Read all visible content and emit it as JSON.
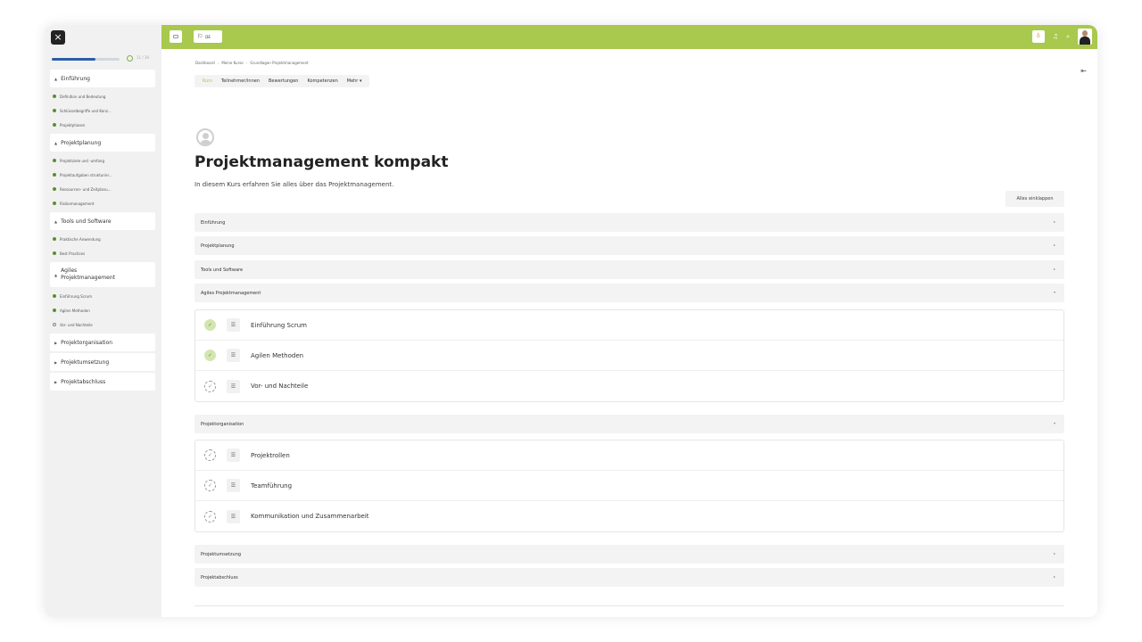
{
  "sidebar": {
    "close_label": "×",
    "progress": {
      "text": "11 / 30",
      "fraction": 0.65
    },
    "sections": [
      {
        "title": "Einführung",
        "open": true,
        "items": [
          {
            "label": "Definition und Bedeutung",
            "done": true
          },
          {
            "label": "Schlüsselbegriffe und Konz...",
            "done": true
          },
          {
            "label": "Projektphasen",
            "done": true
          }
        ]
      },
      {
        "title": "Projektplanung",
        "open": true,
        "items": [
          {
            "label": "Projektziele und -umfang",
            "done": true
          },
          {
            "label": "Projektaufgaben strukturier...",
            "done": true
          },
          {
            "label": "Ressourcen- und Zeitplanu...",
            "done": true
          },
          {
            "label": "Risikomanagement",
            "done": true
          }
        ]
      },
      {
        "title": "Tools und Software",
        "open": true,
        "items": [
          {
            "label": "Praktische Anwendung",
            "done": true
          },
          {
            "label": "Best Practices",
            "done": true
          }
        ]
      },
      {
        "title": "Agiles Projektmanagement",
        "open": true,
        "items": [
          {
            "label": "Einführung Scrum",
            "done": true
          },
          {
            "label": "Agilen Methoden",
            "done": true
          },
          {
            "label": "Vor- und Nachteile",
            "done": false
          }
        ]
      },
      {
        "title": "Projektorganisation",
        "open": false,
        "items": []
      },
      {
        "title": "Projektumsetzung",
        "open": false,
        "items": []
      },
      {
        "title": "Projektabschluss",
        "open": false,
        "items": []
      }
    ]
  },
  "topbar": {
    "language": "DE",
    "accent_color": "#a8c94d"
  },
  "breadcrumb": [
    "Dashboard",
    "Meine Kurse",
    "Grundlagen Projektmanagement"
  ],
  "tabs": [
    {
      "label": "Kurs",
      "active": true
    },
    {
      "label": "Teilnehmer/innen",
      "active": false
    },
    {
      "label": "Bewertungen",
      "active": false
    },
    {
      "label": "Kompetenzen",
      "active": false
    },
    {
      "label": "Mehr ▾",
      "active": false
    }
  ],
  "course": {
    "title": "Projektmanagement kompakt",
    "description": "In diesem Kurs erfahren Sie alles über das Projektmanagement.",
    "collapse_all": "Alles einklappen"
  },
  "sections": {
    "einfuehrung": "Einführung",
    "projektplanung": "Projektplanung",
    "tools": "Tools und Software",
    "agiles": "Agiles Projektmanagement",
    "agiles_items": [
      {
        "label": "Einführung Scrum",
        "done": true
      },
      {
        "label": "Agilen Methoden",
        "done": true
      },
      {
        "label": "Vor- und Nachteile",
        "done": false
      }
    ],
    "organisation": "Projektorganisation",
    "organisation_items": [
      {
        "label": "Projektrollen",
        "done": false
      },
      {
        "label": "Teamführung",
        "done": false
      },
      {
        "label": "Kommunikation und Zusammenarbeit",
        "done": false
      }
    ],
    "umsetzung": "Projektumsetzung",
    "abschluss": "Projektabschluss"
  }
}
